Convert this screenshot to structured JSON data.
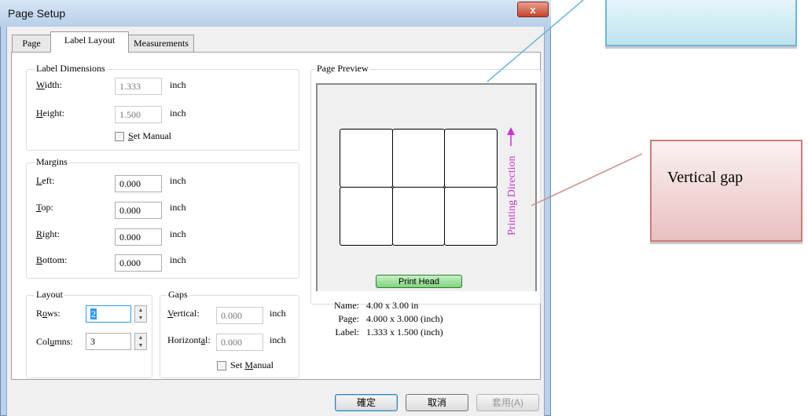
{
  "window": {
    "title": "Page Setup",
    "close_label": "x"
  },
  "tabs": [
    {
      "label": "Page"
    },
    {
      "label": "Label Layout"
    },
    {
      "label": "Measurements"
    }
  ],
  "label_dimensions": {
    "group_label": "Label Dimensions",
    "width_label": "Width:",
    "width_value": "1.333",
    "width_unit": "inch",
    "height_label": "Height:",
    "height_value": "1.500",
    "height_unit": "inch",
    "set_manual_label": "Set Manual"
  },
  "margins": {
    "group_label": "Margins",
    "left_label": "Left:",
    "left_value": "0.000",
    "top_label": "Top:",
    "top_value": "0.000",
    "right_label": "Right:",
    "right_value": "0.000",
    "bottom_label": "Bottom:",
    "bottom_value": "0.000",
    "unit": "inch"
  },
  "layout": {
    "group_label": "Layout",
    "rows_label": "Rows:",
    "rows_value": "2",
    "columns_label": "Columns:",
    "columns_value": "3"
  },
  "gaps": {
    "group_label": "Gaps",
    "vertical_label": "Vertical:",
    "vertical_value": "0.000",
    "horizontal_label": "Horizontal:",
    "horizontal_value": "0.000",
    "unit": "inch",
    "set_manual_label": "Set Manual"
  },
  "preview": {
    "group_label": "Page Preview",
    "rows": 2,
    "columns": 3,
    "printing_direction_label": "Printing Direction",
    "print_head_label": "Print Head",
    "name_key": "Name:",
    "name_value": "4.00 x 3.00 in",
    "page_key": "Page:",
    "page_value": "4.000 x 3.000 (inch)",
    "label_key": "Label:",
    "label_value": "1.333 x 1.500 (inch)"
  },
  "buttons": {
    "ok": "確定",
    "cancel": "取消",
    "apply": "套用(A)"
  },
  "callouts": {
    "vertical_gap": "Vertical gap",
    "top_box": ""
  },
  "colors": {
    "printing_direction": "#cc33cc",
    "print_head": "#7fd37f",
    "callout_blue": "#cfeaf2",
    "callout_red": "#f0c8c8"
  }
}
